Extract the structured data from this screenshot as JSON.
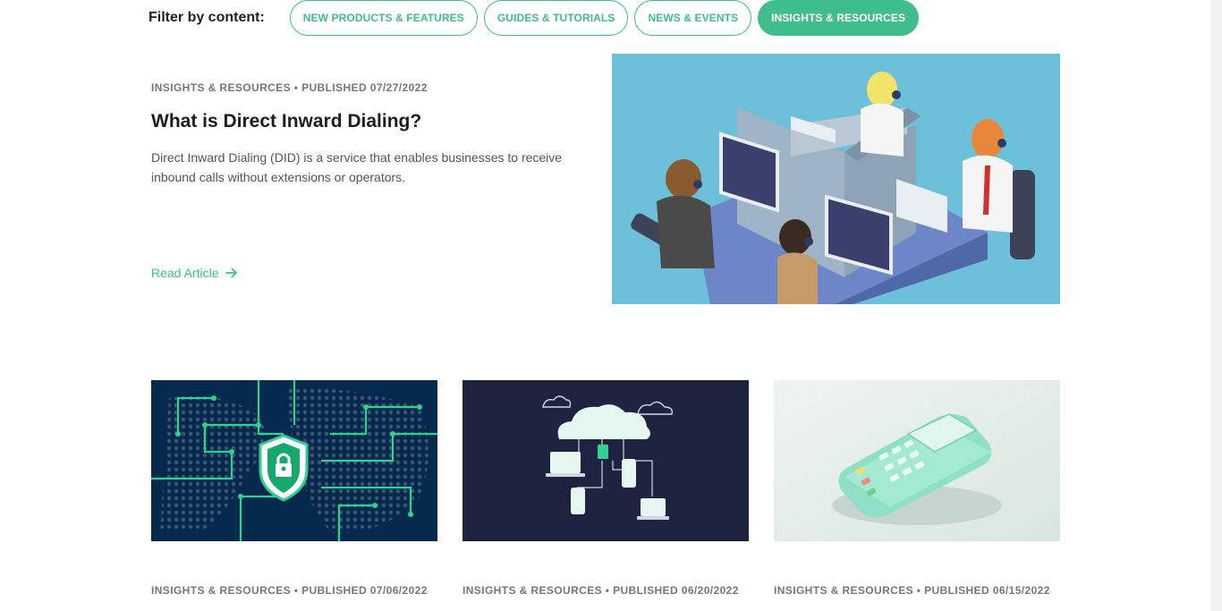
{
  "filter": {
    "label": "Filter by content:",
    "options": [
      {
        "label": "NEW PRODUCTS & FEATURES",
        "active": false
      },
      {
        "label": "GUIDES & TUTORIALS",
        "active": false
      },
      {
        "label": "NEWS & EVENTS",
        "active": false
      },
      {
        "label": "INSIGHTS & RESOURCES",
        "active": true
      }
    ]
  },
  "featured": {
    "meta": "INSIGHTS & RESOURCES • PUBLISHED 07/27/2022",
    "title": "What is Direct Inward Dialing?",
    "description": "Direct Inward Dialing (DID) is a service that enables businesses to receive inbound calls without extensions or operators.",
    "read_more": "Read Article"
  },
  "cards": [
    {
      "meta": "INSIGHTS & RESOURCES • PUBLISHED 07/06/2022",
      "image": "security-map-illustration"
    },
    {
      "meta": "INSIGHTS & RESOURCES • PUBLISHED 06/20/2022",
      "image": "cloud-devices-illustration"
    },
    {
      "meta": "INSIGHTS & RESOURCES • PUBLISHED 06/15/2022",
      "image": "payment-terminal-illustration"
    }
  ],
  "colors": {
    "accent": "#3fbd8a",
    "hero_bg": "#6cc0da",
    "navy": "#062a4d",
    "dark_navy": "#1e2340",
    "mint_bg": "#e2ede8"
  }
}
